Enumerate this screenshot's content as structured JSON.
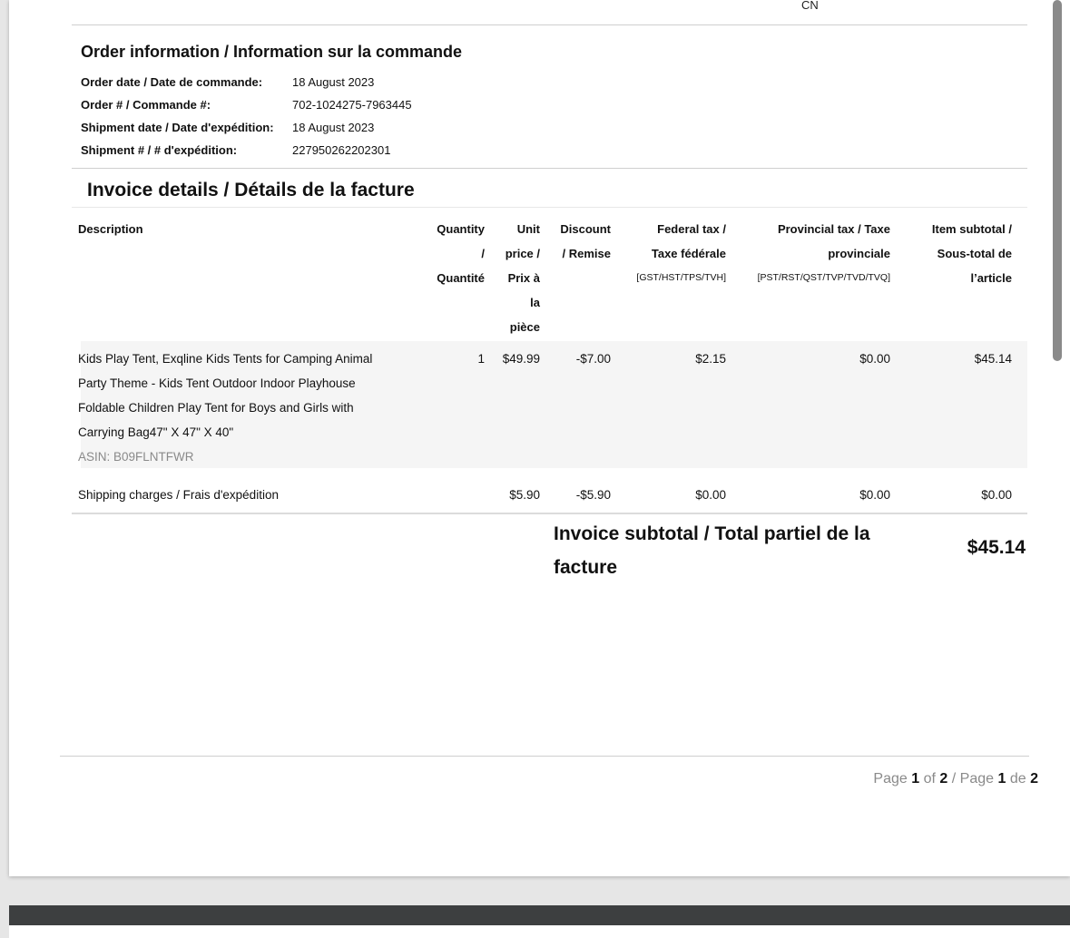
{
  "top": {
    "country_code": "CN"
  },
  "order_info": {
    "heading": "Order information / Information sur la commande",
    "rows": [
      {
        "label": "Order date / Date de commande:",
        "value": "18 August 2023"
      },
      {
        "label": "Order # / Commande #:",
        "value": "702-1024275-7963445"
      },
      {
        "label": "Shipment date / Date d'expédition:",
        "value": "18 August 2023"
      },
      {
        "label": "Shipment # / # d'expédition:",
        "value": "227950262202301"
      }
    ]
  },
  "invoice": {
    "heading": "Invoice details / Détails de la facture",
    "columns": {
      "description": "Description",
      "qty": [
        "Quantity",
        "/",
        "Quantité"
      ],
      "unit": [
        "Unit",
        "price /",
        "Prix à",
        "la",
        "pièce"
      ],
      "discount": [
        "Discount",
        "/ Remise"
      ],
      "federal": [
        "Federal tax /",
        "Taxe fédérale",
        "[GST/HST/TPS/TVH]"
      ],
      "provincial": [
        "Provincial tax / Taxe",
        "provinciale",
        "[PST/RST/QST/TVP/TVD/TVQ]"
      ],
      "subtotal": [
        "Item subtotal /",
        "Sous-total de",
        "l’article"
      ]
    },
    "items": [
      {
        "description_lines": [
          "Kids Play Tent, Exqline Kids Tents for Camping Animal",
          "Party Theme - Kids Tent Outdoor Indoor Playhouse",
          "Foldable Children Play Tent for Boys and Girls with",
          "Carrying Bag47\" X 47\" X 40\""
        ],
        "asin": "ASIN: B09FLNTFWR",
        "qty": "1",
        "unit_price": "$49.99",
        "discount": "-$7.00",
        "federal_tax": "$2.15",
        "provincial_tax": "$0.00",
        "subtotal": "$45.14"
      },
      {
        "description": "Shipping charges / Frais d'expédition",
        "qty": "",
        "unit_price": "$5.90",
        "discount": "-$5.90",
        "federal_tax": "$0.00",
        "provincial_tax": "$0.00",
        "subtotal": "$0.00"
      }
    ],
    "subtotal_label_lines": [
      "Invoice subtotal / Total partiel de la",
      "facture"
    ],
    "subtotal_value": "$45.14"
  },
  "pager": {
    "page_word": "Page",
    "current": "1",
    "of_word": "of",
    "total": "2",
    "sep": "/",
    "page_word_fr": "Page",
    "current_fr": "1",
    "de_word": "de",
    "total_fr": "2"
  }
}
